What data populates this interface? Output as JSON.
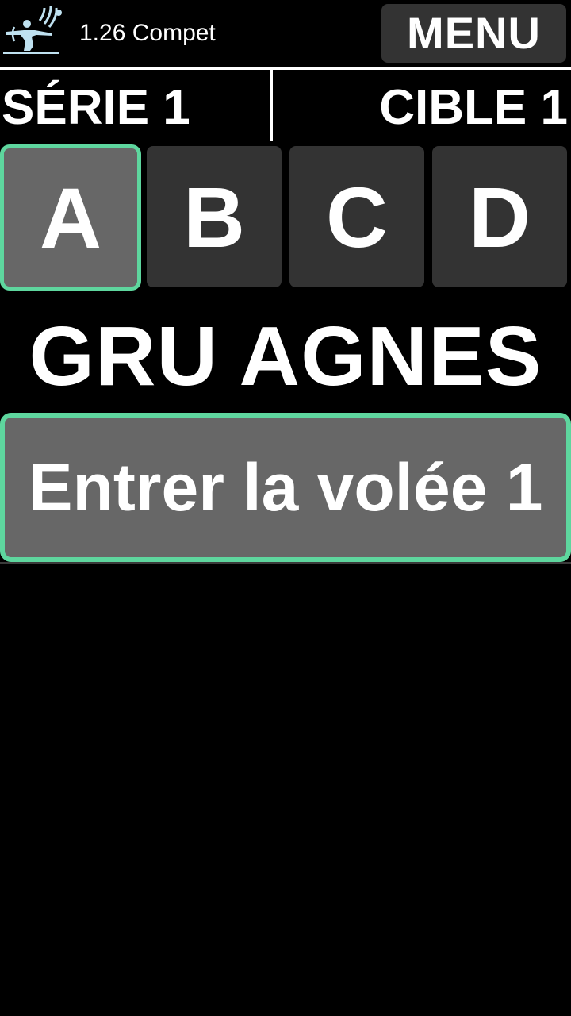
{
  "header": {
    "app_title": "1.26 Compet",
    "menu_label": "MENU",
    "logo_icon": "archer-logo-icon"
  },
  "info": {
    "serie": "SÉRIE 1",
    "cible": "CIBLE 1"
  },
  "tabs": [
    {
      "label": "A",
      "active": true
    },
    {
      "label": "B",
      "active": false
    },
    {
      "label": "C",
      "active": false
    },
    {
      "label": "D",
      "active": false
    }
  ],
  "archer": {
    "name": "GRU AGNES"
  },
  "actions": {
    "enter_volley": "Entrer la volée 1"
  },
  "colors": {
    "background": "#000000",
    "button": "#333333",
    "active_button": "#676767",
    "accent": "#5ed69e",
    "logo": "#bfe1f0"
  }
}
